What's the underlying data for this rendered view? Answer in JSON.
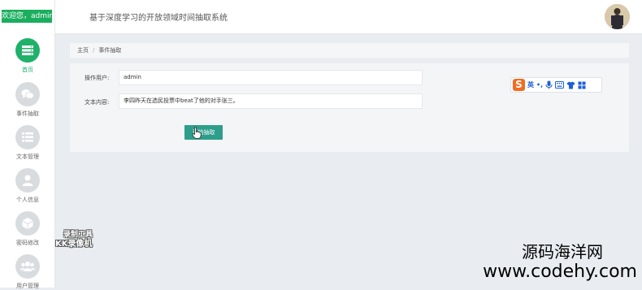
{
  "sidebar": {
    "welcome": "欢迎您，admin",
    "items": [
      {
        "label": "首页",
        "icon": "server-icon",
        "active": true
      },
      {
        "label": "事件抽取",
        "icon": "chat-icon",
        "active": false
      },
      {
        "label": "文本管理",
        "icon": "list-icon",
        "active": false
      },
      {
        "label": "个人信息",
        "icon": "user-icon",
        "active": false
      },
      {
        "label": "密码修改",
        "icon": "cube-icon",
        "active": false
      },
      {
        "label": "用户管理",
        "icon": "users-icon",
        "active": false
      }
    ]
  },
  "header": {
    "title": "基于深度学习的开放领域时间抽取系统"
  },
  "breadcrumb": {
    "home": "主页",
    "separator": "/",
    "current": "事件抽取"
  },
  "form": {
    "user_label": "操作用户:",
    "user_value": "admin",
    "text_label": "文本内容:",
    "text_value": "李四昨天在选民投票中beat了他的对手张三。",
    "submit_label": "开始抽取"
  },
  "ime_toolbar": {
    "logo": "S",
    "lang": "英",
    "punct": "•,",
    "icons": [
      "mic-icon",
      "keyboard-icon",
      "shirt-icon",
      "grid-icon"
    ],
    "accent_color": "#f36c21",
    "icon_color": "#1e5fd8"
  },
  "watermarks": {
    "recorder_line1": "录制工具",
    "recorder_line2": "KK录像机",
    "site_name": "源码海洋网",
    "site_url": "www.codehy.com"
  },
  "colors": {
    "active_green": "#1fb169",
    "welcome_green": "#1aae5e",
    "button_teal": "#2d9e8b",
    "background": "#e9edf1"
  }
}
